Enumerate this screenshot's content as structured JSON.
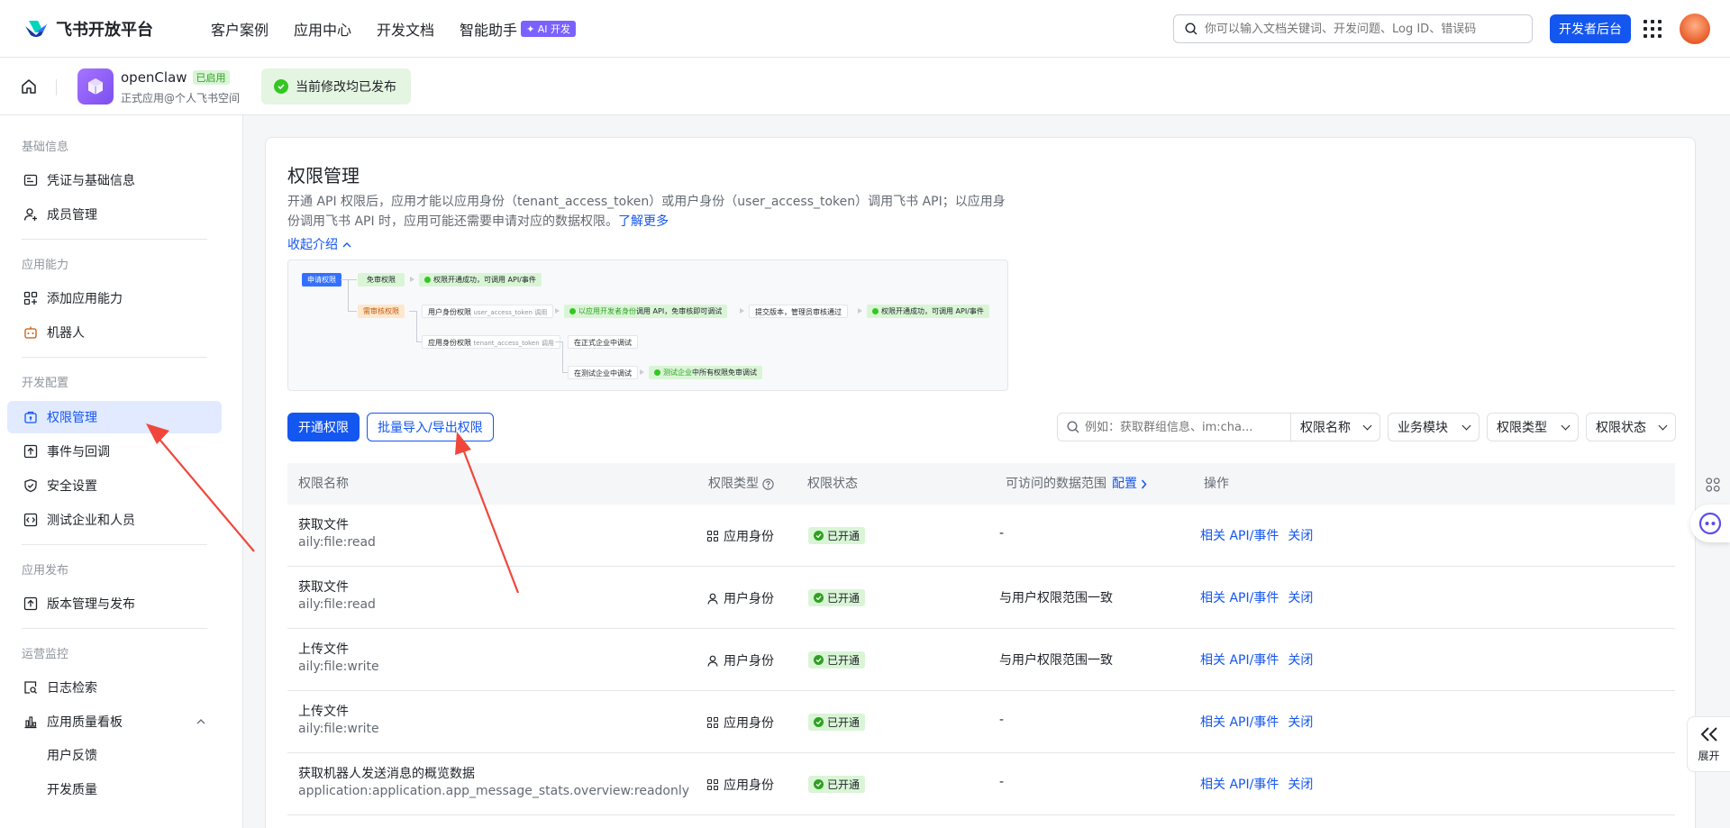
{
  "topbar": {
    "logo": "飞书开放平台",
    "nav": [
      "客户案例",
      "应用中心",
      "开发文档",
      "智能助手"
    ],
    "ai_badge": "✦ AI 开发",
    "search_placeholder": "你可以输入文档关键词、开发问题、Log ID、错误码",
    "dev_console": "开发者后台"
  },
  "appbar": {
    "app_name": "openClaw",
    "app_tag": "已启用",
    "app_sub": "正式应用@个人飞书空间",
    "publish_status": "当前修改均已发布"
  },
  "sidebar": {
    "groups": [
      "基础信息",
      "应用能力",
      "开发配置",
      "应用发布",
      "运营监控"
    ],
    "items": [
      {
        "label": "凭证与基础信息"
      },
      {
        "label": "成员管理"
      },
      {
        "label": "添加应用能力"
      },
      {
        "label": "机器人"
      },
      {
        "label": "权限管理"
      },
      {
        "label": "事件与回调"
      },
      {
        "label": "安全设置"
      },
      {
        "label": "测试企业和人员"
      },
      {
        "label": "版本管理与发布"
      },
      {
        "label": "日志检索"
      },
      {
        "label": "应用质量看板"
      }
    ],
    "subitems": [
      "用户反馈",
      "开发质量"
    ]
  },
  "main": {
    "title": "权限管理",
    "desc": "开通 API 权限后，应用才能以应用身份（tenant_access_token）或用户身份（user_access_token）调用飞书 API；以应用身份调用飞书 API 时，应用可能还需要申请对应的数据权限。",
    "learn_more": "了解更多",
    "collapse": "收起介绍",
    "flow": {
      "apply": "申请权限",
      "free": "免审权限",
      "free_result": "权限开通成功，可调用 API/事件",
      "review": "需审核权限",
      "user_identity": "用户身份权限",
      "user_token": "user_access_token 调用",
      "app_identity": "应用身份权限",
      "tenant_token": "tenant_access_token 调用",
      "dev_call_pre": "以应用开发者身份",
      "dev_call_post": "调用 API，免审核即可调试",
      "submit": "提交版本，管理员审核通过",
      "final_result": "权限开通成功，可调用 API/事件",
      "prod_debug": "在正式企业中调试",
      "test_debug": "在测试企业中调试",
      "test_free_pre": "测试企业",
      "test_free_post": "中所有权限免审调试"
    },
    "btn_open": "开通权限",
    "btn_batch": "批量导入/导出权限",
    "filter_placeholder": "例如：获取群组信息、im:cha...",
    "filters": [
      "权限名称",
      "业务模块",
      "权限类型",
      "权限状态"
    ],
    "columns": [
      "权限名称",
      "权限类型",
      "权限状态",
      "可访问的数据范围",
      "配置",
      "操作"
    ],
    "rows": [
      {
        "name": "获取文件",
        "code": "aily:file:read",
        "type": "应用身份",
        "status": "已开通",
        "scope": "-",
        "api": "相关 API/事件",
        "close": "关闭"
      },
      {
        "name": "获取文件",
        "code": "aily:file:read",
        "type": "用户身份",
        "status": "已开通",
        "scope": "与用户权限范围一致",
        "api": "相关 API/事件",
        "close": "关闭"
      },
      {
        "name": "上传文件",
        "code": "aily:file:write",
        "type": "用户身份",
        "status": "已开通",
        "scope": "与用户权限范围一致",
        "api": "相关 API/事件",
        "close": "关闭"
      },
      {
        "name": "上传文件",
        "code": "aily:file:write",
        "type": "应用身份",
        "status": "已开通",
        "scope": "-",
        "api": "相关 API/事件",
        "close": "关闭"
      },
      {
        "name": "获取机器人发送消息的概览数据",
        "code": "application:application.app_message_stats.overview:readonly",
        "type": "应用身份",
        "status": "已开通",
        "scope": "-",
        "api": "相关 API/事件",
        "close": "关闭"
      }
    ]
  },
  "expand_label": "展开",
  "colors": {
    "primary": "#1456f0",
    "success": "#34c724",
    "annotation": "#f0473d"
  }
}
